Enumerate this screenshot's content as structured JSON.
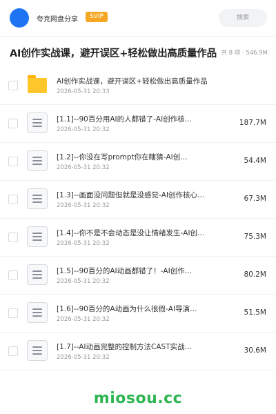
{
  "header": {
    "share_name": "夸克网盘分享",
    "svip_label": "SVIP",
    "search_placeholder": "搜索"
  },
  "folder": {
    "title": "AI创作实战课，避开误区+轻松做出高质量作品",
    "meta": "共 8 项 · 546.9M"
  },
  "items": [
    {
      "type": "folder",
      "name": "AI创作实战课，避开误区+轻松做出高质量作品",
      "date": "2026-05-31 20:33",
      "size": ""
    },
    {
      "type": "file",
      "name": "[1.1]--90百分用AI的人都错了-AI创作核…",
      "date": "2026-05-31 20:32",
      "size": "187.7M"
    },
    {
      "type": "file",
      "name": "[1.2]--你没在写prompt你在瞎猜-AI创…",
      "date": "2026-05-31 20:32",
      "size": "54.4M"
    },
    {
      "type": "file",
      "name": "[1.3]--画面没问题但就是没感觉-AI创作核心…",
      "date": "2026-05-31 20:32",
      "size": "67.3M"
    },
    {
      "type": "file",
      "name": "[1.4]--你不是不会动态是没让情绪发生-AI创…",
      "date": "2026-05-31 20:32",
      "size": "75.3M"
    },
    {
      "type": "file",
      "name": "[1.5]--90百分的AI动画都错了！-AI创作…",
      "date": "2026-05-31 20:32",
      "size": "80.2M"
    },
    {
      "type": "file",
      "name": "[1.6]--90百分的A动画为什么很假-AI导演…",
      "date": "2026-05-31 20:32",
      "size": "51.5M"
    },
    {
      "type": "file",
      "name": "[1.7]--AI动画完整的控制方法CAST实战…",
      "date": "2026-05-31 20:32",
      "size": "30.6M"
    }
  ],
  "watermark": "miosou.cc",
  "colors": {
    "accent": "#1e74f2",
    "svip": "#f5a623",
    "folder": "#ffc72c",
    "watermark": "#2db551"
  }
}
